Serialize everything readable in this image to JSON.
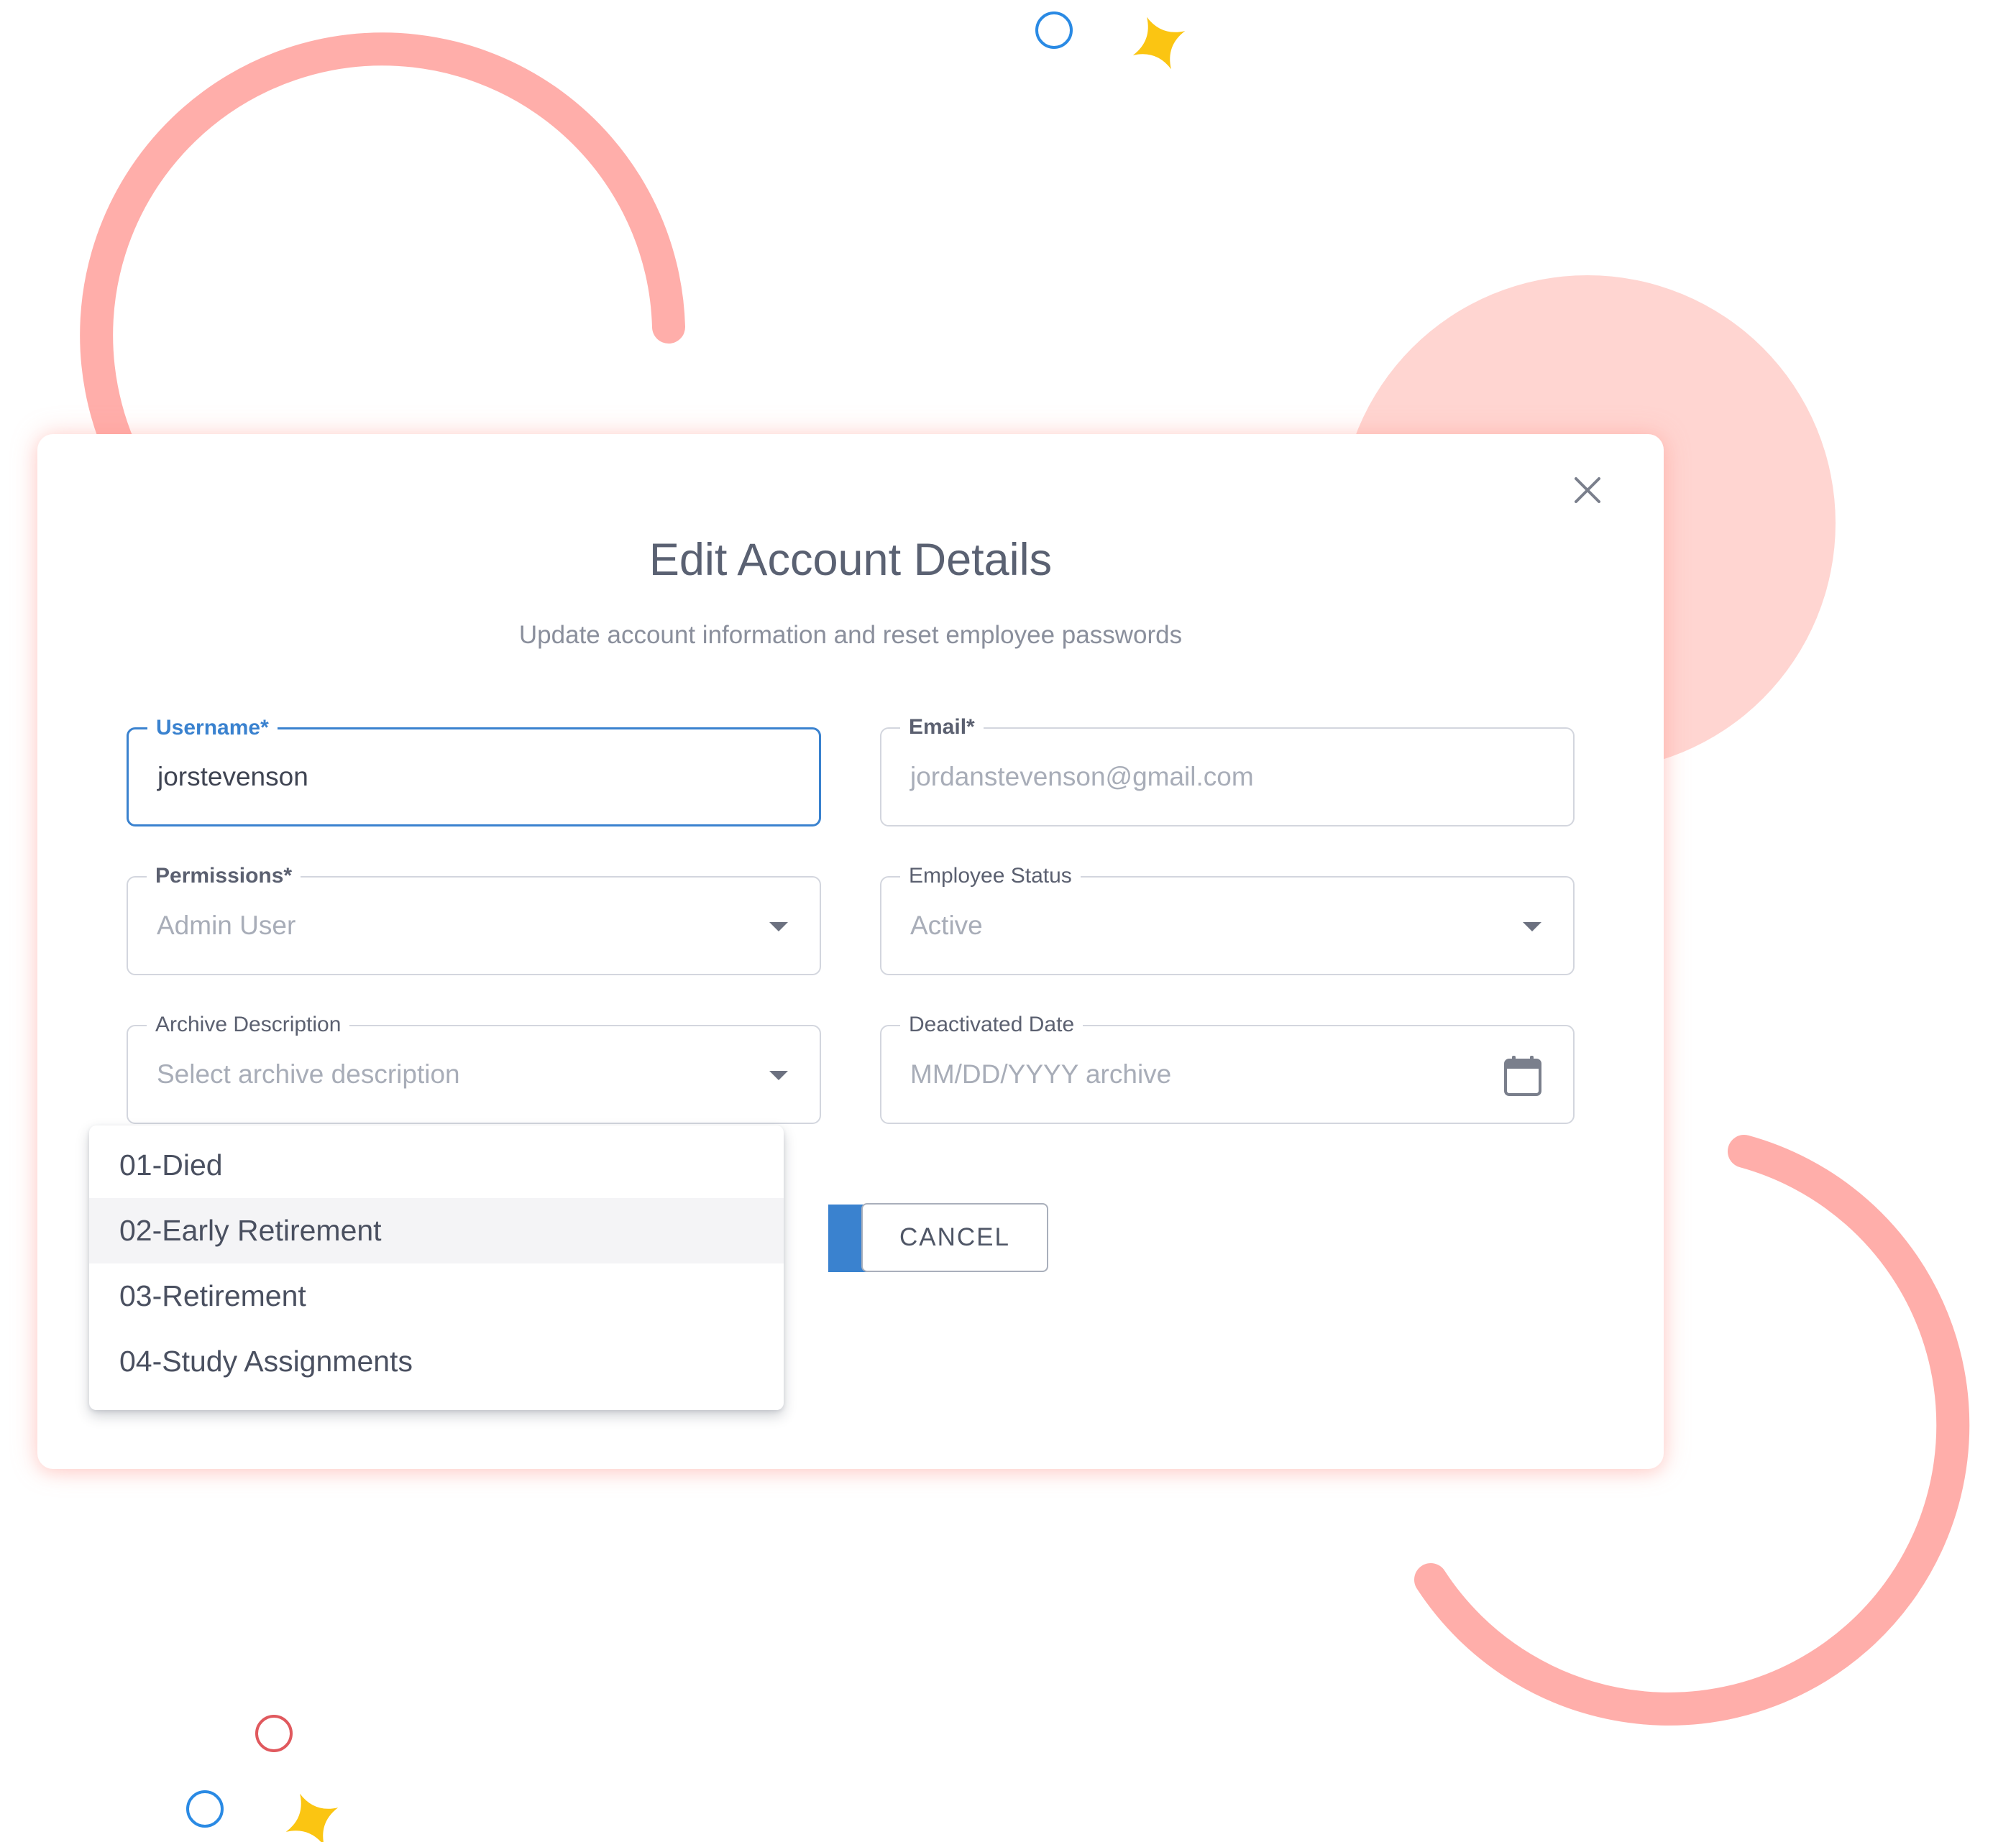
{
  "modal": {
    "title": "Edit Account Details",
    "subtitle": "Update account information and reset employee passwords",
    "close_icon": "close-icon"
  },
  "fields": {
    "username": {
      "label": "Username*",
      "value": "jorstevenson"
    },
    "email": {
      "label": "Email*",
      "value": "jordanstevenson@gmail.com"
    },
    "permissions": {
      "label": "Permissions*",
      "value": "Admin User"
    },
    "employee_status": {
      "label": "Employee Status",
      "value": "Active"
    },
    "archive_description": {
      "label": "Archive Description",
      "placeholder": "Select archive description"
    },
    "deactivated_date": {
      "label": "Deactivated Date",
      "placeholder": "MM/DD/YYYY archive",
      "icon": "calendar-icon"
    }
  },
  "actions": {
    "cancel_label": "CANCEL"
  },
  "dropdown": {
    "options": [
      "01-Died",
      "02-Early Retirement",
      "03-Retirement",
      "04-Study Assignments"
    ],
    "highlighted_index": 1
  },
  "colors": {
    "accent": "#3a82cf",
    "decor_pink": "#ffaeaa",
    "decor_light_pink": "#ffd5d1",
    "decor_yellow": "#fbc512",
    "decor_blue": "#2a8ae4",
    "decor_red": "#e0595e"
  }
}
